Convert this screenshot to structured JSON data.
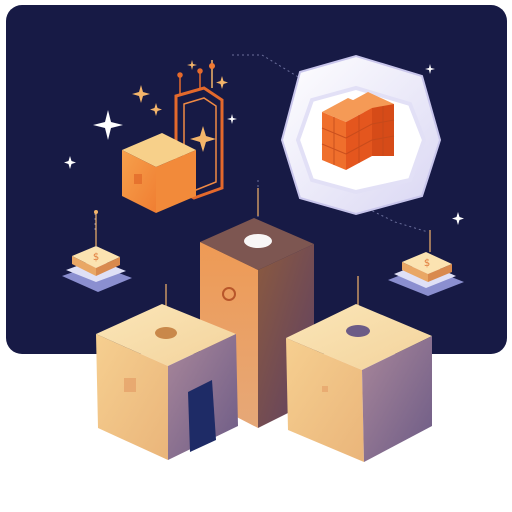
{
  "colors": {
    "panel_bg": "#171a45",
    "background": "#ffffff",
    "accent_orange": "#f07a33",
    "block_cream": "#f5cc8a",
    "block_purple": "#6a4f74",
    "pillar_tan": "#b9793f",
    "hex_frame": "#e9e8f8",
    "sparkle_white": "#ffffff",
    "sparkle_gold": "#f4b56a",
    "door_navy": "#1e2b66"
  },
  "icons": {
    "left_chip_glyph": "$",
    "right_chip_glyph": "$"
  }
}
